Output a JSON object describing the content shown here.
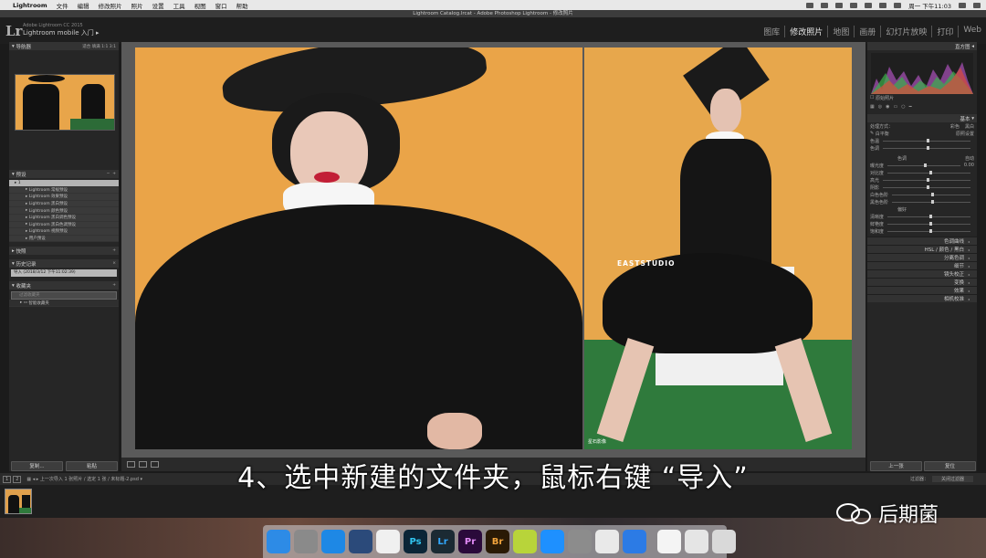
{
  "menubar": {
    "apple": "",
    "app": "Lightroom",
    "items": [
      "文件",
      "编辑",
      "修改照片",
      "照片",
      "设置",
      "工具",
      "视图",
      "窗口",
      "帮助"
    ],
    "clock": "周一 下午11:03"
  },
  "window": {
    "title": "Lightroom Catalog.lrcat - Adobe Photoshop Lightroom - 修改照片"
  },
  "lr_header": {
    "logo": "Lr",
    "product": "Adobe Lightroom CC 2015",
    "identity_plate": "Lightroom mobile 入门 ▸",
    "modules": [
      "图库",
      "修改照片",
      "地图",
      "画册",
      "幻灯片放映",
      "打印",
      "Web"
    ],
    "active_module": "修改照片"
  },
  "left_panel": {
    "navigator": {
      "title": "导航器",
      "options": "适合  填满  1:1  3:1"
    },
    "presets": {
      "title": "预设",
      "items": [
        "1",
        "Lightroom 常规预设",
        "Lightroom 效果预设",
        "Lightroom 黑白预设",
        "Lightroom 颜色预设",
        "Lightroom 黑白调色预设",
        "Lightroom 黑白色调预设",
        "Lightroom 视频预设",
        "用户预设"
      ]
    },
    "snapshots": {
      "title": "快照"
    },
    "history": {
      "title": "历史记录",
      "entry": "导入 (2018/3/12 下午11:02:39)"
    },
    "collections": {
      "title": "收藏夹",
      "filter": "过滤收藏夹",
      "item": "智能收藏夹"
    },
    "copy_button": "复制...",
    "paste_button": "粘贴"
  },
  "photo": {
    "watermark_text": "EASTSTUDIO",
    "corner_text": "星石影像"
  },
  "right_panel": {
    "histogram": {
      "title": "直方图",
      "caption": "原始照片"
    },
    "basic": {
      "title": "基本",
      "treatment_label": "处理方式：",
      "treatment_color": "彩色",
      "treatment_bw": "黑白",
      "wb_label": "白平衡",
      "wb_value": "原照设置",
      "temp_label": "色温",
      "tint_label": "色调",
      "tone_label": "色调",
      "auto_label": "自动",
      "exposure_label": "曝光度",
      "exposure_value": "0.00",
      "contrast_label": "对比度",
      "highlights_label": "高光",
      "shadows_label": "阴影",
      "whites_label": "白色色阶",
      "blacks_label": "黑色色阶",
      "presence_label": "偏好",
      "clarity_label": "清晰度",
      "vibrance_label": "鲜艳度",
      "saturation_label": "饱和度"
    },
    "sections": [
      "色调曲线",
      "HSL / 颜色 / 黑白",
      "分离色调",
      "细节",
      "镜头校正",
      "变换",
      "效果",
      "相机校准"
    ],
    "prev_button": "上一张",
    "reset_button": "复位"
  },
  "filmstrip_bar": {
    "pages": [
      "1",
      "2"
    ],
    "source_text": "上一次导入  1 张照片 / 选定 1 张 / 未标题-2.psd ▾",
    "filter_label": "过滤器：",
    "filter_value": "关闭过滤器"
  },
  "caption": "4、选中新建的文件夹，鼠标右键 “导入”",
  "brand_watermark": "后期菌",
  "dock": {
    "items": [
      {
        "name": "finder",
        "label": "",
        "color": "#2d8be6"
      },
      {
        "name": "launchpad",
        "label": "",
        "color": "#8a8a8a"
      },
      {
        "name": "safari",
        "label": "",
        "color": "#1e88e5"
      },
      {
        "name": "quicktime",
        "label": "",
        "color": "#2b4a7a"
      },
      {
        "name": "photos",
        "label": "",
        "color": "#f0f0f0"
      },
      {
        "name": "photoshop",
        "label": "Ps",
        "color": "#0b2537"
      },
      {
        "name": "lightroom",
        "label": "Lr",
        "color": "#1b2a33"
      },
      {
        "name": "premiere",
        "label": "Pr",
        "color": "#2a0a3a"
      },
      {
        "name": "bridge",
        "label": "Br",
        "color": "#2a1a05"
      },
      {
        "name": "app-lime",
        "label": "",
        "color": "#b8d43a"
      },
      {
        "name": "app-store",
        "label": "",
        "color": "#1e90ff"
      },
      {
        "name": "system-preferences",
        "label": "",
        "color": "#8c8c8c"
      },
      {
        "name": "qq",
        "label": "",
        "color": "#e9e9e9"
      },
      {
        "name": "browser",
        "label": "",
        "color": "#2c7be5"
      },
      {
        "name": "preview",
        "label": "",
        "color": "#f4f4f4"
      },
      {
        "name": "documents",
        "label": "",
        "color": "#e5e5e5"
      },
      {
        "name": "trash",
        "label": "",
        "color": "#d9d9d9"
      }
    ]
  }
}
